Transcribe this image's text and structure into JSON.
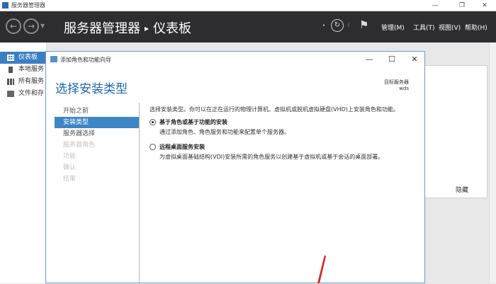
{
  "window": {
    "title": "服务器管理器"
  },
  "header": {
    "breadcrumb_root": "服务器管理器",
    "breadcrumb_current": "仪表板",
    "menus": [
      "管理(M)",
      "工具(T)",
      "视图(V)",
      "帮助(H)"
    ]
  },
  "sidebar": {
    "items": [
      {
        "label": "仪表板",
        "icon": "dashboard-icon"
      },
      {
        "label": "本地服务",
        "icon": "server-icon"
      },
      {
        "label": "所有服务",
        "icon": "servers-icon"
      },
      {
        "label": "文件和存",
        "icon": "file-storage-icon"
      }
    ]
  },
  "background": {
    "hide_label": "隐藏"
  },
  "dialog": {
    "title": "添加角色和功能向导",
    "heading": "选择安装类型",
    "target_label": "目标服务器",
    "target_value": "wds",
    "steps": [
      {
        "label": "开始之前",
        "state": "normal"
      },
      {
        "label": "安装类型",
        "state": "active"
      },
      {
        "label": "服务器选择",
        "state": "normal"
      },
      {
        "label": "服务器角色",
        "state": "disabled"
      },
      {
        "label": "功能",
        "state": "disabled"
      },
      {
        "label": "确认",
        "state": "disabled"
      },
      {
        "label": "结果",
        "state": "disabled"
      }
    ],
    "intro": "选择安装类型。你可以在正在运行的物理计算机、虚拟机或脱机虚拟硬盘(VHD)上安装角色和功能。",
    "options": [
      {
        "title": "基于角色或基于功能的安装",
        "description": "通过添加角色、角色服务和功能来配置单个服务器。",
        "checked": true
      },
      {
        "title": "远程桌面服务安装",
        "description": "为虚拟桌面基础结构(VDI)安装所需的角色服务以创建基于虚拟机或基于会话的桌面部署。",
        "checked": false
      }
    ]
  },
  "colors": {
    "accent": "#3d86c6",
    "heading": "#1e66b5",
    "header_bg": "#2d2d30",
    "annotation_arrow": "#d9261c"
  }
}
